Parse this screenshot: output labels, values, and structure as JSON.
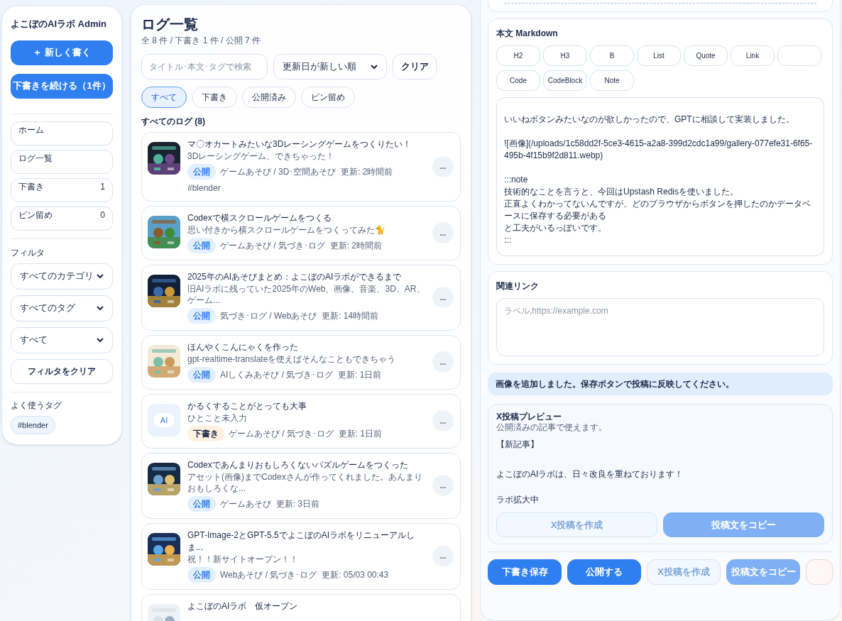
{
  "sidebar": {
    "title": "よこぼのAIラボ Admin",
    "actions": [
      {
        "label": "＋ 新しく書く"
      },
      {
        "label": "下書きを続ける（1件）"
      }
    ],
    "nav": [
      {
        "label": "ホーム",
        "selected": false
      },
      {
        "label": "ログ一覧",
        "selected": false
      },
      {
        "label": "下書き",
        "count": "1",
        "selected": false
      },
      {
        "label": "ピン留め",
        "count": "0",
        "selected": false
      }
    ],
    "filter_label": "フィルタ",
    "filters": [
      "すべてのカテゴリ",
      "すべてのタグ",
      "すべて"
    ],
    "clear_filter": "フィルタをクリア",
    "tags_label": "よく使うタグ",
    "tags": [
      "#blender"
    ]
  },
  "list": {
    "title": "ログ一覧",
    "summary": "全 8 件 / 下書き 1 件 / 公開 7 件",
    "search": {
      "placeholder": "タイトル･本文･タグで検索"
    },
    "sort": "更新日が新しい順",
    "clear": "クリア",
    "chips": [
      {
        "label": "すべて",
        "selected": true
      },
      {
        "label": "下書き",
        "selected": false
      },
      {
        "label": "公開済み",
        "selected": false
      },
      {
        "label": "ピン留め",
        "selected": false
      }
    ],
    "heading": "すべてのログ (8)",
    "items": [
      {
        "kind": "picture",
        "title": "マ〇オカートみたいな3Dレーシングゲームをつくりたい！",
        "summary": "3Dレーシングゲーム、できちゃった！",
        "draft": false,
        "status_label": "公開",
        "meta": "ゲームあそび / 3D･空間あそび  更新: 2時間前",
        "tag": "#blender",
        "menu": "..."
      },
      {
        "kind": "picture",
        "title": "Codexで横スクロールゲームをつくる",
        "summary": "思い付きから横スクロールゲームをつくってみた🐈",
        "draft": false,
        "status_label": "公開",
        "meta": "ゲームあそび / 気づき･ログ  更新: 2時間前",
        "menu": "..."
      },
      {
        "kind": "picture",
        "title": "2025年のAIあそびまとめ：よこぼのAIラボができるまで",
        "summary": "旧AIラボに残っていた2025年のWeb、画像、音楽、3D、AR、ゲーム...",
        "draft": false,
        "status_label": "公開",
        "meta": "気づき･ログ / Webあそび  更新: 14時間前",
        "menu": "..."
      },
      {
        "kind": "picture",
        "title": "ほんやくこんにゃくを作った",
        "summary": "gpt-realtime-translateを使えばそんなこともできちゃう",
        "draft": false,
        "status_label": "公開",
        "meta": "AIしくみあそび / 気づき･ログ  更新: 1日前",
        "menu": "..."
      },
      {
        "kind": "placeholder",
        "thumb_label": "AI",
        "title": "かるくすることがとっても大事",
        "summary": "ひとこと未入力",
        "draft": true,
        "status_label": "下書き",
        "meta": "ゲームあそび / 気づき･ログ  更新: 1日前",
        "menu": "..."
      },
      {
        "kind": "picture",
        "title": "Codexであんまりおもしろくないパズルゲームをつくった",
        "summary": "アセット(画像)までCodexさんが作ってくれました。あんまりおもしろくな...",
        "draft": false,
        "status_label": "公開",
        "meta": "ゲームあそび  更新: 3日前",
        "menu": "..."
      },
      {
        "kind": "picture",
        "title": "GPT-Image-2とGPT-5.5でよこぼのAIラボをリニューアルしま...",
        "summary": "祝！！新サイトオープン！！",
        "draft": false,
        "status_label": "公開",
        "meta": "Webあそび / 気づき･ログ  更新: 05/03 00:43",
        "menu": "..."
      },
      {
        "kind": "picture",
        "title": "よこぼのAIラボ　仮オープン"
      }
    ]
  },
  "editor": {
    "markdown_label": "本文 Markdown",
    "toolbar": [
      "H2",
      "H3",
      "B",
      "List",
      "Quote",
      "Link",
      "Code",
      "CodeBlock",
      "Note"
    ],
    "body": [
      [
        "いいねボタンみたいなのが欲しかったので、GPTに相談して実装しました。"
      ],
      [
        "![画像](/uploads/1c58dd2f-5ce3-4615-a2a8-399d2cdc1a99/gallery-077efe31-6f65-495b-4f15b9f2d811.webp)"
      ],
      [
        ":::note",
        "技術的なことを言うと、今回はUpstash Redisを使いました。",
        "正直よくわかってないんですが、どのブラウザからボタンを押したのかデータベースに保存する必要がある",
        "と工夫がいるっぽいです。",
        ":::"
      ]
    ],
    "links_label": "関連リンク",
    "links": {
      "placeholder": "ラベル,https://example.com"
    },
    "notice": "画像を追加しました。保存ボタンで投稿に反映してください。",
    "preview": {
      "title": "X投稿プレビュー",
      "subtitle": "公開済みの記事で使えます。",
      "lines": [
        "【新記事】",
        "よこぼのAIラボは、日々改良を重ねております！",
        "ラボ拡大中"
      ],
      "buttons": [
        {
          "label": "X投稿を作成",
          "kind": "ghost"
        },
        {
          "label": "投稿文をコピー",
          "kind": "soft"
        }
      ]
    },
    "actions": [
      {
        "label": "下書き保存",
        "kind": "primary"
      },
      {
        "label": "公開する",
        "kind": "primary"
      },
      {
        "label": "X投稿を作成",
        "kind": "ghost"
      },
      {
        "label": "投稿文をコピー",
        "kind": "soft"
      },
      {
        "kind": "danger"
      }
    ]
  }
}
